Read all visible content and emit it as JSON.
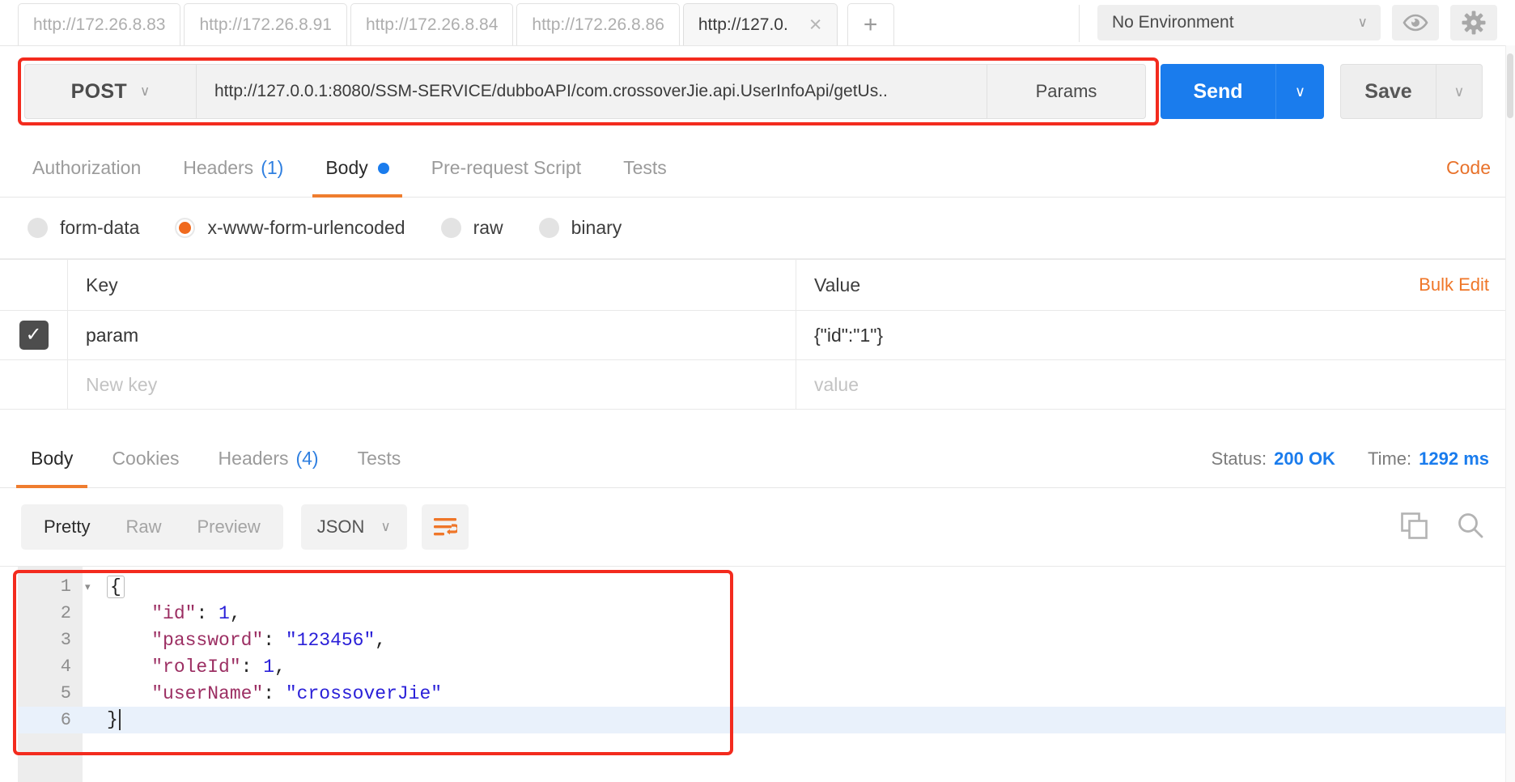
{
  "tabstrip": {
    "tabs": [
      {
        "label": "http://172.26.8.83",
        "active": false
      },
      {
        "label": "http://172.26.8.91",
        "active": false
      },
      {
        "label": "http://172.26.8.84",
        "active": false
      },
      {
        "label": "http://172.26.8.86",
        "active": false
      },
      {
        "label": "http://127.0.",
        "active": true
      }
    ],
    "new_tab_label": "+",
    "close_label": "×",
    "environment": {
      "selected": "No Environment",
      "caret": "∨"
    },
    "eye_icon": "eye-icon",
    "gear_icon": "gear-icon"
  },
  "request": {
    "method": "POST",
    "method_caret": "∨",
    "url": "http://127.0.0.1:8080/SSM-SERVICE/dubboAPI/com.crossoverJie.api.UserInfoApi/getUs..",
    "params_label": "Params",
    "send_label": "Send",
    "send_caret": "∨",
    "save_label": "Save",
    "save_caret": "∨",
    "tabs": [
      {
        "label": "Authorization",
        "count": "",
        "active": false,
        "dot": false
      },
      {
        "label": "Headers",
        "count": "(1)",
        "active": false,
        "dot": false
      },
      {
        "label": "Body",
        "count": "",
        "active": true,
        "dot": true
      },
      {
        "label": "Pre-request Script",
        "count": "",
        "active": false,
        "dot": false
      },
      {
        "label": "Tests",
        "count": "",
        "active": false,
        "dot": false
      }
    ],
    "code_link": "Code",
    "body_types": [
      {
        "label": "form-data",
        "selected": false
      },
      {
        "label": "x-www-form-urlencoded",
        "selected": true
      },
      {
        "label": "raw",
        "selected": false
      },
      {
        "label": "binary",
        "selected": false
      }
    ],
    "table": {
      "headers": {
        "key": "Key",
        "value": "Value"
      },
      "bulk_edit": "Bulk Edit",
      "rows": [
        {
          "checked": true,
          "check_glyph": "✓",
          "key": "param",
          "value": "{\"id\":\"1\"}",
          "placeholder": false
        }
      ],
      "new_row": {
        "key_placeholder": "New key",
        "value_placeholder": "value"
      }
    }
  },
  "response": {
    "tabs": [
      {
        "label": "Body",
        "count": "",
        "active": true
      },
      {
        "label": "Cookies",
        "count": "",
        "active": false
      },
      {
        "label": "Headers",
        "count": "(4)",
        "active": false
      },
      {
        "label": "Tests",
        "count": "",
        "active": false
      }
    ],
    "status_label": "Status:",
    "status_value": "200 OK",
    "time_label": "Time:",
    "time_value": "1292 ms",
    "view_modes": [
      {
        "label": "Pretty",
        "active": true
      },
      {
        "label": "Raw",
        "active": false
      },
      {
        "label": "Preview",
        "active": false
      }
    ],
    "format": "JSON",
    "format_caret": "∨",
    "wrap_icon": "word-wrap-icon",
    "copy_icon": "copy-icon",
    "search_icon": "search-icon",
    "body_lines": [
      {
        "no": "1",
        "fold": "▾",
        "tokens": [
          {
            "t": "{",
            "c": "pun-box"
          }
        ],
        "highlight": false
      },
      {
        "no": "2",
        "fold": "",
        "tokens": [
          {
            "t": "    ",
            "c": "pun"
          },
          {
            "t": "\"id\"",
            "c": "key"
          },
          {
            "t": ": ",
            "c": "pun"
          },
          {
            "t": "1",
            "c": "num"
          },
          {
            "t": ",",
            "c": "pun"
          }
        ],
        "highlight": false
      },
      {
        "no": "3",
        "fold": "",
        "tokens": [
          {
            "t": "    ",
            "c": "pun"
          },
          {
            "t": "\"password\"",
            "c": "key"
          },
          {
            "t": ": ",
            "c": "pun"
          },
          {
            "t": "\"123456\"",
            "c": "str"
          },
          {
            "t": ",",
            "c": "pun"
          }
        ],
        "highlight": false
      },
      {
        "no": "4",
        "fold": "",
        "tokens": [
          {
            "t": "    ",
            "c": "pun"
          },
          {
            "t": "\"roleId\"",
            "c": "key"
          },
          {
            "t": ": ",
            "c": "pun"
          },
          {
            "t": "1",
            "c": "num"
          },
          {
            "t": ",",
            "c": "pun"
          }
        ],
        "highlight": false
      },
      {
        "no": "5",
        "fold": "",
        "tokens": [
          {
            "t": "    ",
            "c": "pun"
          },
          {
            "t": "\"userName\"",
            "c": "key"
          },
          {
            "t": ": ",
            "c": "pun"
          },
          {
            "t": "\"crossoverJie\"",
            "c": "str"
          }
        ],
        "highlight": false
      },
      {
        "no": "6",
        "fold": "",
        "tokens": [
          {
            "t": "}",
            "c": "pun"
          }
        ],
        "highlight": true,
        "caret": true
      }
    ]
  },
  "colors": {
    "accent_orange": "#ef7d2f",
    "send_blue": "#1a7ced",
    "highlight_red": "#f32b1e",
    "json_key": "#9c2f63",
    "json_value": "#2a20d8"
  }
}
